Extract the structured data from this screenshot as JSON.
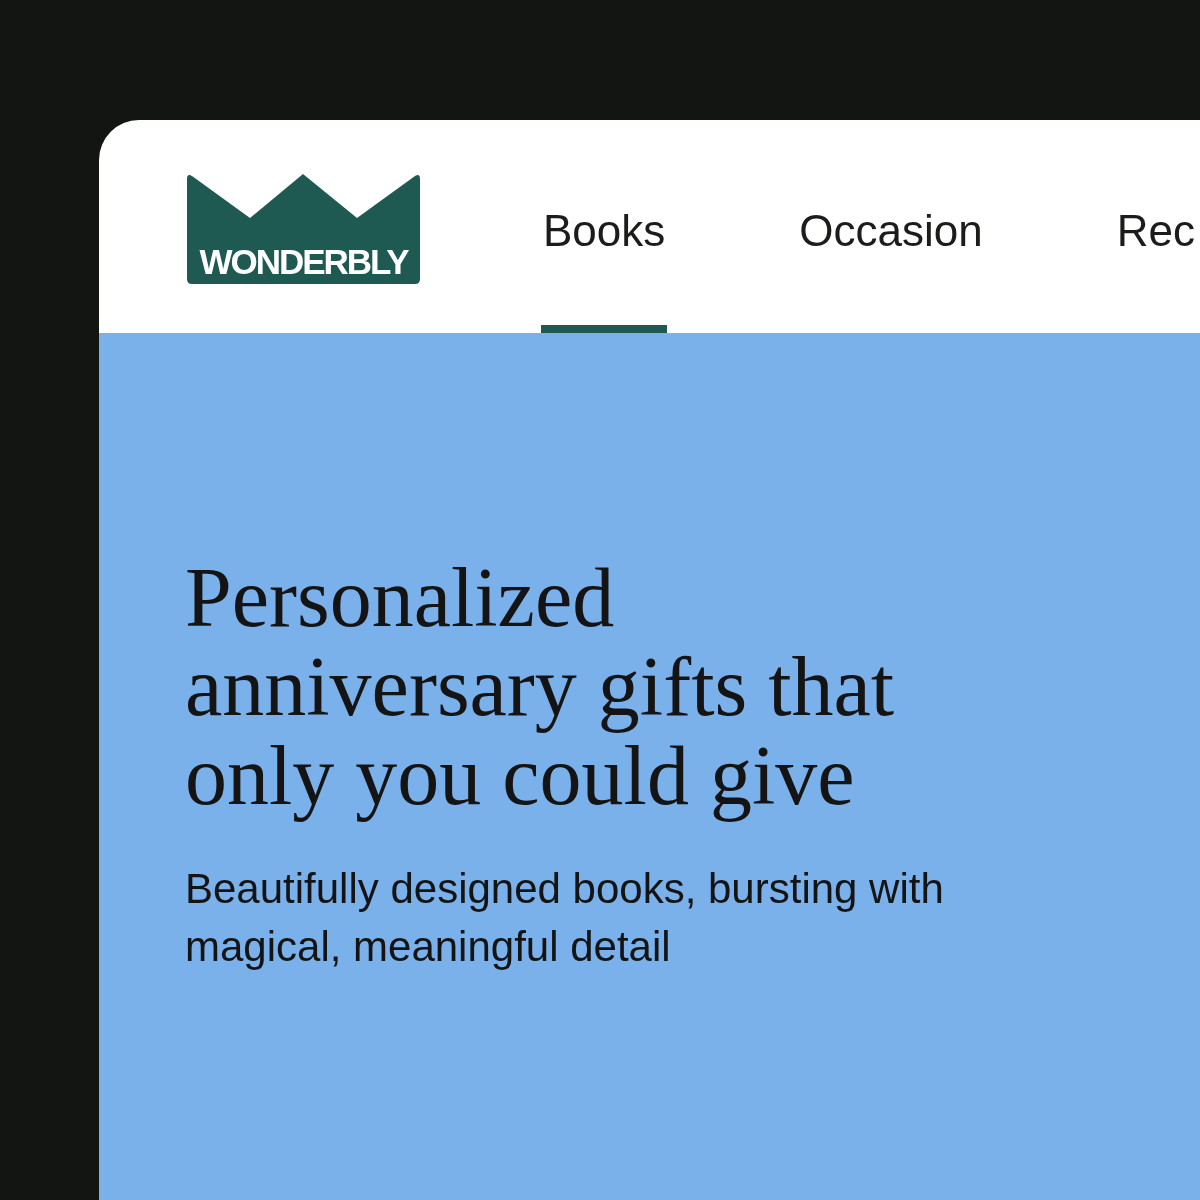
{
  "logo": {
    "text": "WONDERBLY"
  },
  "nav": {
    "tabs": [
      {
        "label": "Books",
        "selected": true
      },
      {
        "label": "Occasion",
        "selected": false
      },
      {
        "label": "Rec",
        "selected": false
      }
    ]
  },
  "hero": {
    "heading": "Personalized anniversary gifts that only you could give",
    "subheading": "Beautifully designed books, bursting with magical, meaningful detail"
  }
}
